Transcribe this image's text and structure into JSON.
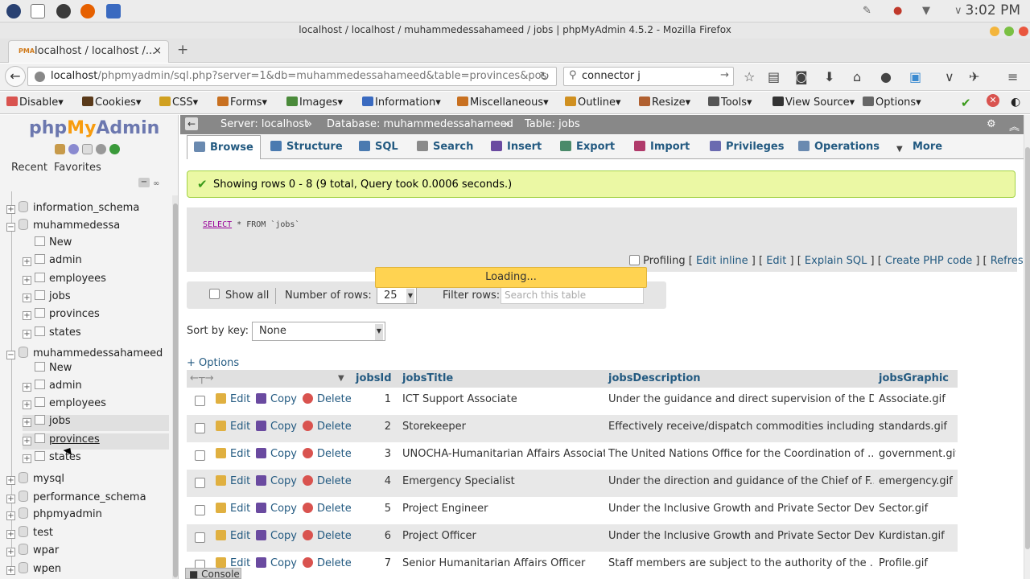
{
  "os": {
    "clock": "3:02 PM",
    "app_icons": [
      "fedora-icon",
      "terminal-icon",
      "browser-icon",
      "firefox-icon",
      "mail-icon"
    ]
  },
  "window": {
    "title": "localhost / localhost / muhammedessahameed / jobs | phpMyAdmin 4.5.2 - Mozilla Firefox"
  },
  "tab": {
    "label": "localhost / localhost /...",
    "close": "×",
    "favicon": "PMA",
    "new_tab": "+"
  },
  "navbar": {
    "url_host": "localhost",
    "url_path": "/phpmyadmin/sql.php?server=1&db=muhammedessahameed&table=provinces&pos",
    "search_value": "connector j"
  },
  "devbar": {
    "items": [
      "Disable",
      "Cookies",
      "CSS",
      "Forms",
      "Images",
      "Information",
      "Miscellaneous",
      "Outline",
      "Resize",
      "Tools",
      "View Source",
      "Options"
    ],
    "colors": [
      "#d9534f",
      "#5a3a1a",
      "#d0a020",
      "#c87020",
      "#4a8a3a",
      "#3a6ac0",
      "#c87020",
      "#d09020",
      "#b06030",
      "#555555",
      "#333333",
      "#666666"
    ]
  },
  "sidebar": {
    "logo_php": "php",
    "logo_my": "My",
    "logo_admin": "Admin",
    "recent": "Recent",
    "favorites": "Favorites",
    "tree": [
      {
        "label": "information_schema",
        "type": "db",
        "level": 0,
        "sign": "+"
      },
      {
        "label": "muhammedessa",
        "type": "db",
        "level": 0,
        "sign": "−"
      },
      {
        "label": "New",
        "type": "new",
        "level": 1,
        "sign": ""
      },
      {
        "label": "admin",
        "type": "table",
        "level": 1,
        "sign": "+"
      },
      {
        "label": "employees",
        "type": "table",
        "level": 1,
        "sign": "+"
      },
      {
        "label": "jobs",
        "type": "table",
        "level": 1,
        "sign": "+"
      },
      {
        "label": "provinces",
        "type": "table",
        "level": 1,
        "sign": "+"
      },
      {
        "label": "states",
        "type": "table",
        "level": 1,
        "sign": "+"
      },
      {
        "label": "muhammedessahameed",
        "type": "db",
        "level": 0,
        "sign": "−"
      },
      {
        "label": "New",
        "type": "new",
        "level": 1,
        "sign": ""
      },
      {
        "label": "admin",
        "type": "table",
        "level": 1,
        "sign": "+"
      },
      {
        "label": "employees",
        "type": "table",
        "level": 1,
        "sign": "+"
      },
      {
        "label": "jobs",
        "type": "table",
        "level": 1,
        "sign": "+",
        "selected": true
      },
      {
        "label": "provinces",
        "type": "table",
        "level": 1,
        "sign": "+",
        "hover": true
      },
      {
        "label": "states",
        "type": "table",
        "level": 1,
        "sign": "+"
      },
      {
        "label": "mysql",
        "type": "db",
        "level": 0,
        "sign": "+"
      },
      {
        "label": "performance_schema",
        "type": "db",
        "level": 0,
        "sign": "+"
      },
      {
        "label": "phpmyadmin",
        "type": "db",
        "level": 0,
        "sign": "+"
      },
      {
        "label": "test",
        "type": "db",
        "level": 0,
        "sign": "+"
      },
      {
        "label": "wpar",
        "type": "db",
        "level": 0,
        "sign": "+"
      },
      {
        "label": "wpen",
        "type": "db",
        "level": 0,
        "sign": "+"
      }
    ]
  },
  "breadcrumb": {
    "server": "Server: localhost",
    "database": "Database: muhammedessahameed",
    "table": "Table: jobs"
  },
  "menu": {
    "tabs": [
      "Browse",
      "Structure",
      "SQL",
      "Search",
      "Insert",
      "Export",
      "Import",
      "Privileges",
      "Operations",
      "More"
    ],
    "active": "Browse"
  },
  "result": {
    "message": "Showing rows 0 - 8 (9 total, Query took 0.0006 seconds.)",
    "sql_select": "SELECT",
    "sql_rest": "* FROM `jobs`",
    "profiling": "Profiling",
    "links": [
      "Edit inline",
      "Edit",
      "Explain SQL",
      "Create PHP code",
      "Refresh"
    ],
    "loading": "Loading..."
  },
  "controls": {
    "show_all": "Show all",
    "rows_label": "Number of rows:",
    "rows_value": "25",
    "filter_label": "Filter rows:",
    "filter_placeholder": "Search this table",
    "sort_label": "Sort by key:",
    "sort_value": "None",
    "options": "+ Options"
  },
  "table": {
    "headers": [
      "jobsId",
      "jobsTitle",
      "jobsDescription",
      "jobsGraphic"
    ],
    "actions": {
      "edit": "Edit",
      "copy": "Copy",
      "delete": "Delete"
    },
    "rows": [
      {
        "id": "1",
        "title": "ICT Support Associate",
        "desc": "Under the guidance and direct supervision of the D...",
        "graphic": "Associate.gif"
      },
      {
        "id": "2",
        "title": "Storekeeper",
        "desc": "Effectively receive/dispatch commodities including...",
        "graphic": "standards.gif"
      },
      {
        "id": "3",
        "title": "UNOCHA-Humanitarian Affairs Associate",
        "desc": "The United Nations Office for the Coordination of ...",
        "graphic": "government.gif"
      },
      {
        "id": "4",
        "title": "Emergency Specialist",
        "desc": "Under the direction and guidance of the Chief of F...",
        "graphic": "emergency.gif"
      },
      {
        "id": "5",
        "title": "Project Engineer",
        "desc": "Under the Inclusive Growth and Private Sector Deve...",
        "graphic": "Sector.gif"
      },
      {
        "id": "6",
        "title": "Project Officer",
        "desc": "Under the Inclusive Growth and Private Sector Deve...",
        "graphic": "Kurdistan.gif"
      },
      {
        "id": "7",
        "title": "Senior Humanitarian Affairs Officer",
        "desc": "Staff members are subject to the authority of the ...",
        "graphic": "Profile.gif"
      }
    ]
  },
  "console": "Console"
}
